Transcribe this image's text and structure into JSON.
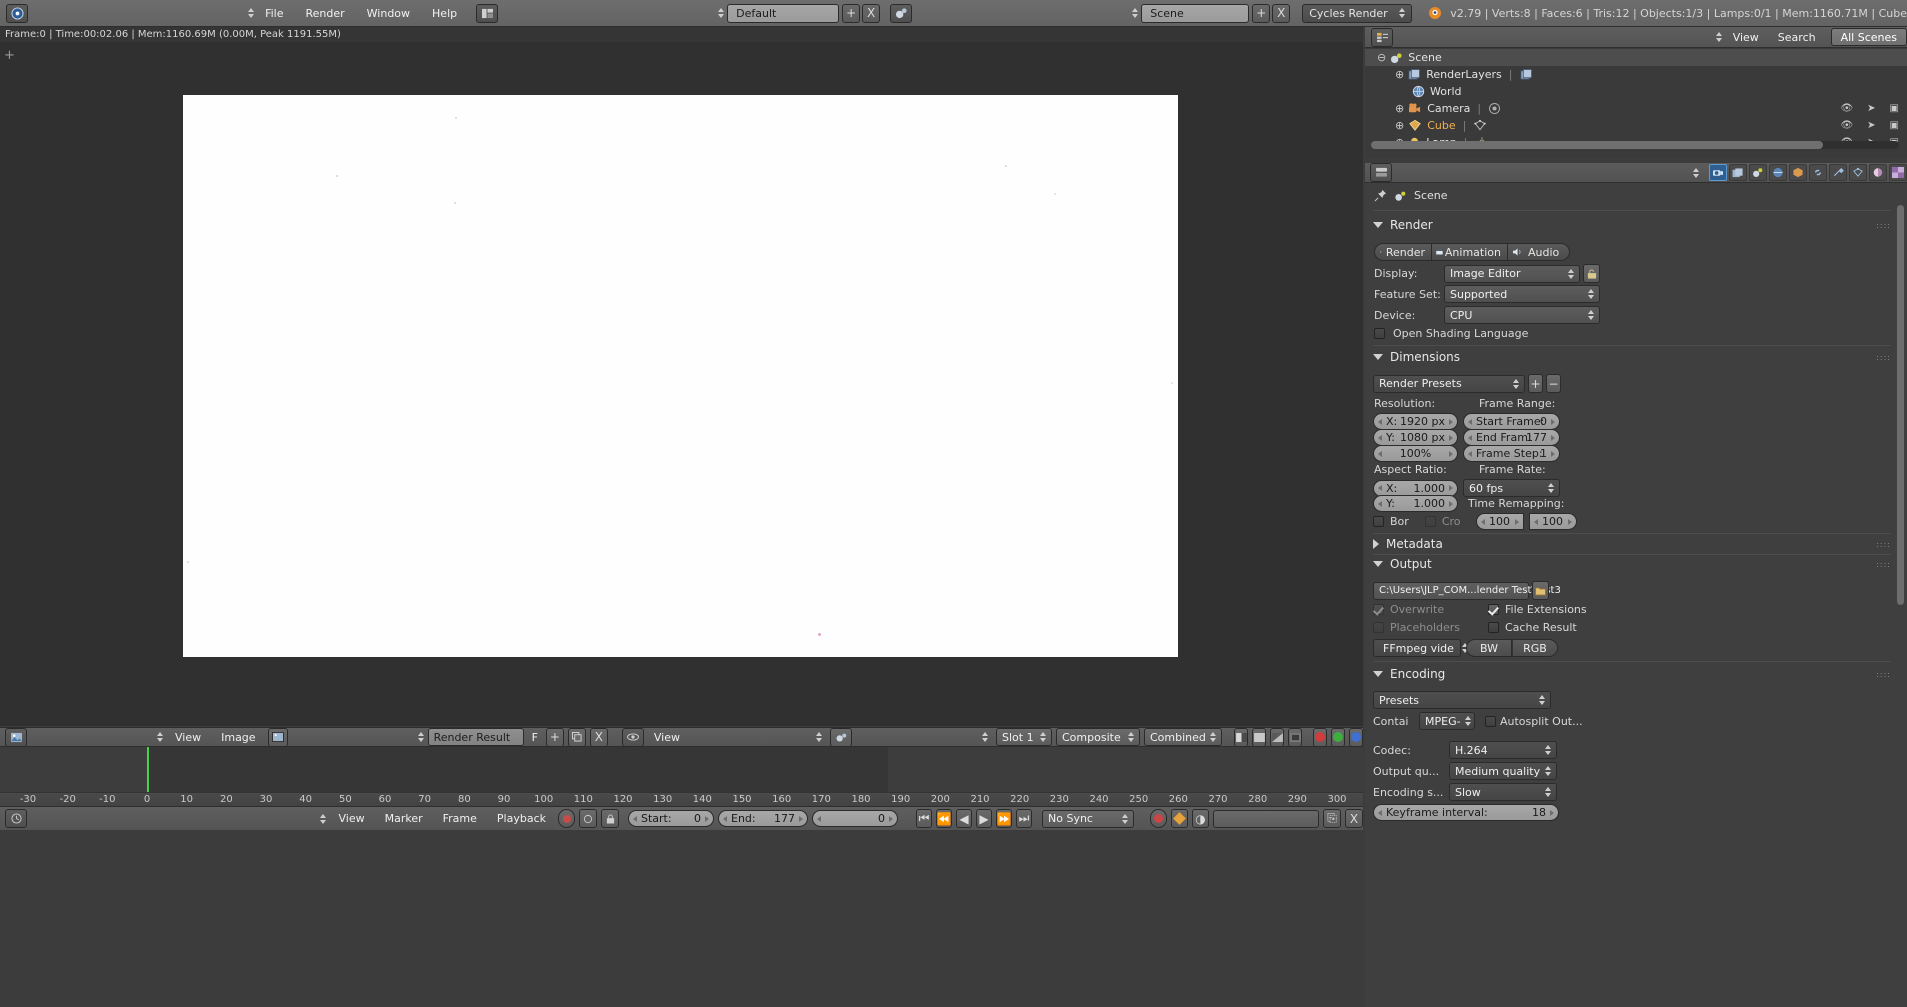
{
  "topbar": {
    "app_icon": "blender-logo-icon",
    "menus": [
      "File",
      "Render",
      "Window",
      "Help"
    ],
    "screen_layout": "Default",
    "scene_name": "Scene",
    "engine": "Cycles Render",
    "add_label": "+",
    "remove_label": "X",
    "stats": "v2.79 | Verts:8 | Faces:6 | Tris:12 | Objects:1/3 | Lamps:0/1 | Mem:1160.71M | Cube"
  },
  "statusline": "Frame:0 | Time:00:02.06 | Mem:1160.69M (0.00M, Peak 1191.55M)",
  "outliner": {
    "menus": [
      "View",
      "Search"
    ],
    "display_mode": "All Scenes",
    "rows": [
      {
        "label": "Scene",
        "icon": "scene-icon",
        "indent": 18,
        "expander": "minus",
        "selected": true,
        "highlight": false,
        "icons": false
      },
      {
        "label": "RenderLayers",
        "icon": "renderlayers-icon",
        "indent": 36,
        "expander": "plus",
        "selected": false,
        "highlight": false,
        "icons": false
      },
      {
        "label": "World",
        "icon": "world-icon",
        "indent": 36,
        "expander": "none",
        "selected": false,
        "highlight": false,
        "icons": false
      },
      {
        "label": "Camera",
        "icon": "camera-icon",
        "indent": 36,
        "expander": "plus",
        "selected": false,
        "highlight": false,
        "icons": true
      },
      {
        "label": "Cube",
        "icon": "mesh-icon",
        "indent": 36,
        "expander": "plus",
        "selected": false,
        "highlight": true,
        "icons": true
      },
      {
        "label": "Lamp",
        "icon": "lamp-icon",
        "indent": 36,
        "expander": "plus",
        "selected": false,
        "highlight": false,
        "icons": true
      }
    ],
    "row_icons": [
      "eye-icon",
      "cursor-arrow-icon",
      "camera-render-icon"
    ]
  },
  "properties": {
    "tabs": [
      {
        "name": "render-tab",
        "glyph": "▣",
        "active": true
      },
      {
        "name": "render-layers-tab",
        "glyph": "❐",
        "active": false
      },
      {
        "name": "scene-tab",
        "glyph": "⚫",
        "active": false
      },
      {
        "name": "world-tab",
        "glyph": "●",
        "active": false
      },
      {
        "name": "object-tab",
        "glyph": "■",
        "active": false
      },
      {
        "name": "constraints-tab",
        "glyph": "⚭",
        "active": false
      },
      {
        "name": "modifiers-tab",
        "glyph": "⚒",
        "active": false
      },
      {
        "name": "data-tab",
        "glyph": "▽",
        "active": false
      },
      {
        "name": "material-tab",
        "glyph": "◐",
        "active": false
      },
      {
        "name": "texture-tab",
        "glyph": "▦",
        "active": false
      }
    ],
    "breadcrumb": "Scene",
    "render": {
      "section": "Render",
      "buttons": [
        "Render",
        "Animation",
        "Audio"
      ],
      "display_label": "Display:",
      "display_value": "Image Editor",
      "feature_set_label": "Feature Set:",
      "feature_set_value": "Supported",
      "device_label": "Device:",
      "device_value": "CPU",
      "osl_label": "Open Shading Language",
      "osl_checked": false
    },
    "dimensions": {
      "section": "Dimensions",
      "presets": "Render Presets",
      "resolution_label": "Resolution:",
      "res_x_label": "X:",
      "res_x_value": "1920 px",
      "res_y_label": "Y:",
      "res_y_value": "1080 px",
      "percentage": "100%",
      "frame_range_label": "Frame Range:",
      "start_frame_label": "Start Frame:",
      "start_frame_value": "0",
      "end_frame_label": "End Fram:",
      "end_frame_value": "177",
      "frame_step_label": "Frame Step:",
      "frame_step_value": "1",
      "aspect_label": "Aspect Ratio:",
      "aspect_x_label": "X:",
      "aspect_x_value": "1.000",
      "aspect_y_label": "Y:",
      "aspect_y_value": "1.000",
      "frame_rate_label": "Frame Rate:",
      "frame_rate_value": "60 fps",
      "time_remapping_label": "Time Remapping:",
      "remap_old": "100",
      "remap_new": "100",
      "border_label": "Bor",
      "border_checked": false,
      "crop_label": "Cro",
      "crop_checked": false
    },
    "metadata": {
      "section": "Metadata",
      "expanded": false
    },
    "output": {
      "section": "Output",
      "path": "C:\\Users\\JLP_COM...lender Test\\Test3",
      "overwrite_label": "Overwrite",
      "overwrite_checked": true,
      "overwrite_dim": true,
      "file_extensions_label": "File Extensions",
      "file_extensions_checked": true,
      "placeholders_label": "Placeholders",
      "placeholders_checked": false,
      "placeholders_dim": true,
      "cache_result_label": "Cache Result",
      "cache_result_checked": false,
      "format": "FFmpeg vide",
      "bw_label": "BW",
      "rgb_label": "RGB"
    },
    "encoding": {
      "section": "Encoding",
      "presets": "Presets",
      "container_label": "Contai",
      "container_value": "MPEG-",
      "autosplit_label": "Autosplit Out...",
      "autosplit_checked": false,
      "codec_label": "Codec:",
      "codec_value": "H.264",
      "output_quality_label": "Output qu...",
      "output_quality_value": "Medium quality",
      "encoding_speed_label": "Encoding s...",
      "encoding_speed_value": "Slow",
      "keyframe_label": "Keyframe interval:",
      "keyframe_value": "18"
    }
  },
  "image_editor": {
    "menus": [
      "View",
      "Image"
    ],
    "image_name": "Render Result",
    "fake_user_label": "F",
    "view_menu": "View",
    "slot": "Slot 1",
    "layer": "Composite",
    "pass": "Combined",
    "channel_icons": [
      "color-and-alpha-icon",
      "color-icon",
      "alpha-icon",
      "zdepth-icon"
    ],
    "channel_swatches": [
      "#d23b3b",
      "#3fae3f",
      "#3f6fd2"
    ]
  },
  "timeline": {
    "menus": [
      "View",
      "Marker",
      "Frame",
      "Playback"
    ],
    "start_label": "Start:",
    "start_value": "0",
    "end_label": "End:",
    "end_value": "177",
    "current_frame": "0",
    "sync_mode": "No Sync",
    "ruler_ticks": [
      "-30",
      "-20",
      "-10",
      "0",
      "10",
      "20",
      "30",
      "40",
      "50",
      "60",
      "70",
      "80",
      "90",
      "100",
      "110",
      "120",
      "130",
      "140",
      "150",
      "160",
      "170",
      "180",
      "190",
      "200",
      "210",
      "220",
      "230",
      "240",
      "250",
      "260",
      "270",
      "280",
      "290",
      "300"
    ],
    "playhead_frame": "0"
  }
}
